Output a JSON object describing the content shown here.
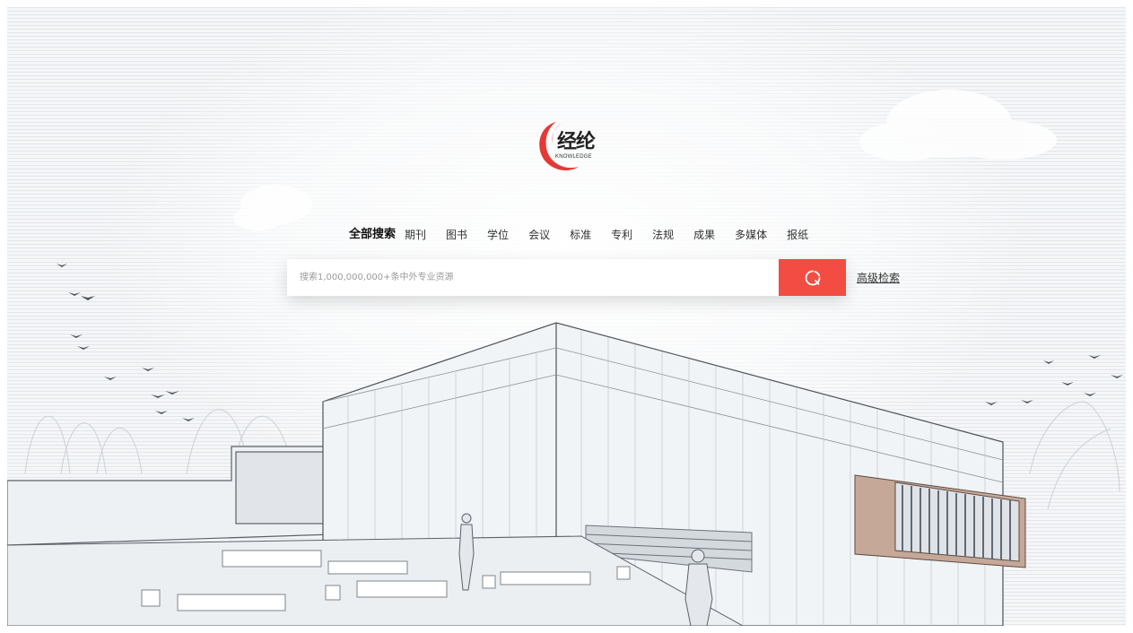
{
  "logo": {
    "name": "经纶",
    "subtitle": "KNOWLEDGE"
  },
  "tabs": [
    {
      "label": "全部搜索",
      "active": true
    },
    {
      "label": "期刊",
      "active": false
    },
    {
      "label": "图书",
      "active": false
    },
    {
      "label": "学位",
      "active": false
    },
    {
      "label": "会议",
      "active": false
    },
    {
      "label": "标准",
      "active": false
    },
    {
      "label": "专利",
      "active": false
    },
    {
      "label": "法规",
      "active": false
    },
    {
      "label": "成果",
      "active": false
    },
    {
      "label": "多媒体",
      "active": false
    },
    {
      "label": "报纸",
      "active": false
    }
  ],
  "search": {
    "value": "",
    "placeholder": "搜索1,000,000,000+条中外专业资源",
    "button_icon": "search-icon"
  },
  "advanced_search_label": "高级检索",
  "colors": {
    "accent": "#f24c43",
    "logo_red": "#e53935",
    "text": "#333333"
  }
}
